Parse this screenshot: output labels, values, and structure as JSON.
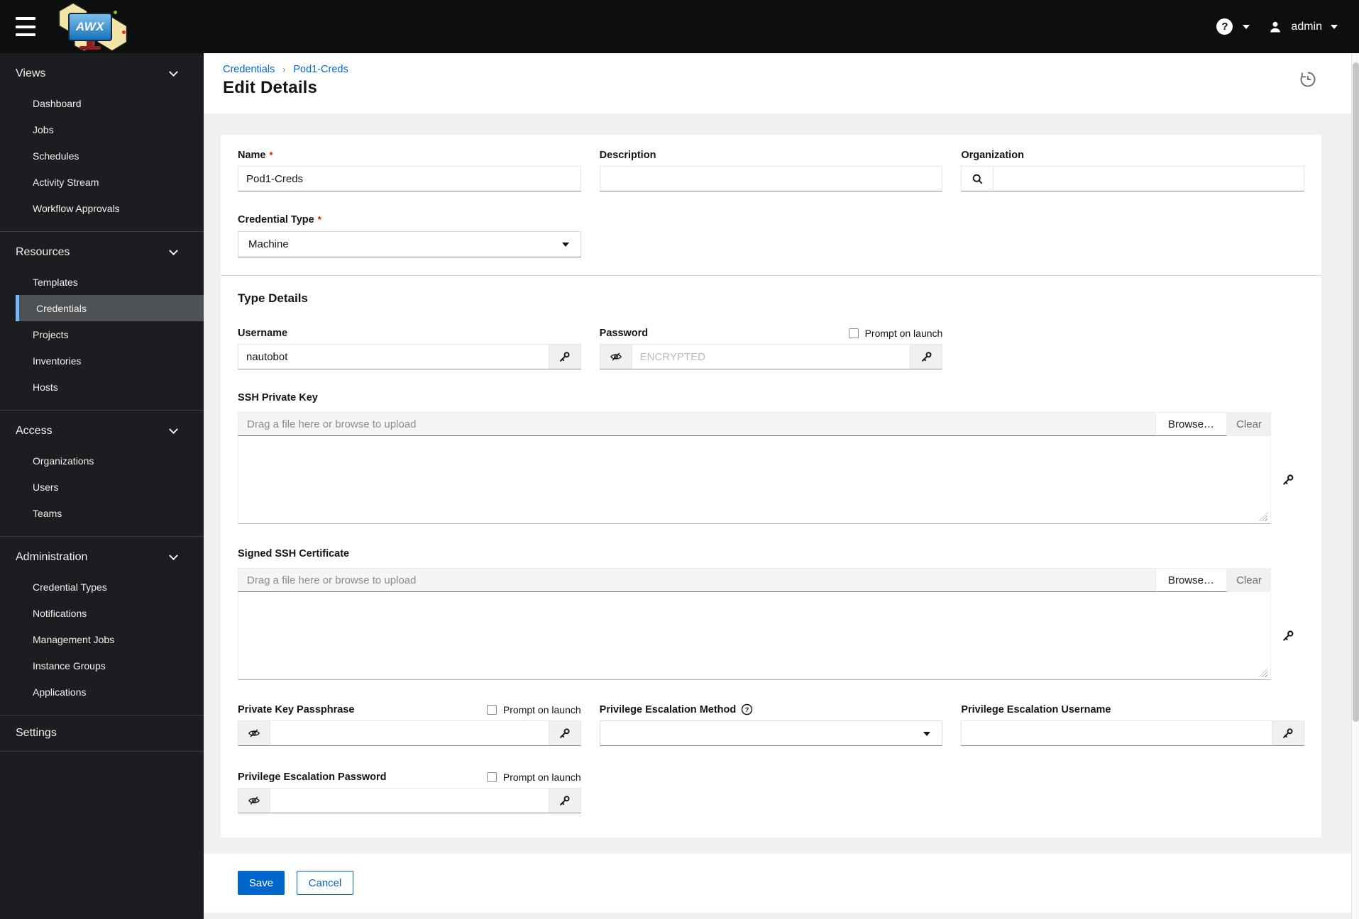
{
  "topbar": {
    "brand": "AWX",
    "help_glyph": "?",
    "user": "admin"
  },
  "sidebar": {
    "sections": [
      {
        "label": "Views",
        "items": [
          "Dashboard",
          "Jobs",
          "Schedules",
          "Activity Stream",
          "Workflow Approvals"
        ]
      },
      {
        "label": "Resources",
        "items": [
          "Templates",
          "Credentials",
          "Projects",
          "Inventories",
          "Hosts"
        ],
        "selected": "Credentials"
      },
      {
        "label": "Access",
        "items": [
          "Organizations",
          "Users",
          "Teams"
        ]
      },
      {
        "label": "Administration",
        "items": [
          "Credential Types",
          "Notifications",
          "Management Jobs",
          "Instance Groups",
          "Applications"
        ]
      },
      {
        "label": "Settings",
        "items": []
      }
    ]
  },
  "header": {
    "breadcrumb": [
      "Credentials",
      "Pod1-Creds"
    ],
    "separator": "›",
    "title": "Edit Details"
  },
  "form": {
    "required_marker": "*",
    "prompt_on_launch": "Prompt on launch",
    "name": {
      "label": "Name",
      "value": "Pod1-Creds"
    },
    "description": {
      "label": "Description",
      "value": ""
    },
    "organization": {
      "label": "Organization",
      "value": ""
    },
    "credential_type": {
      "label": "Credential Type",
      "value": "Machine"
    },
    "type_details_heading": "Type Details",
    "username": {
      "label": "Username",
      "value": "nautobot"
    },
    "password": {
      "label": "Password",
      "placeholder": "ENCRYPTED",
      "prompt_checked": false
    },
    "upload": {
      "placeholder": "Drag a file here or browse to upload",
      "browse": "Browse…",
      "clear": "Clear"
    },
    "ssh_private_key": {
      "label": "SSH Private Key",
      "value": ""
    },
    "signed_ssh_certificate": {
      "label": "Signed SSH Certificate",
      "value": ""
    },
    "private_key_passphrase": {
      "label": "Private Key Passphrase",
      "value": "",
      "prompt_checked": false
    },
    "privilege_escalation_method": {
      "label": "Privilege Escalation Method",
      "value": ""
    },
    "privilege_escalation_username": {
      "label": "Privilege Escalation Username",
      "value": ""
    },
    "privilege_escalation_password": {
      "label": "Privilege Escalation Password",
      "value": "",
      "prompt_checked": false
    }
  },
  "footer": {
    "save": "Save",
    "cancel": "Cancel"
  },
  "colors": {
    "accent": "#0066cc",
    "nav_selected_bar": "#73bcf7",
    "required": "#c9190b",
    "topbar_bg": "#0d0e0e",
    "sidebar_bg": "#1b1d21"
  }
}
